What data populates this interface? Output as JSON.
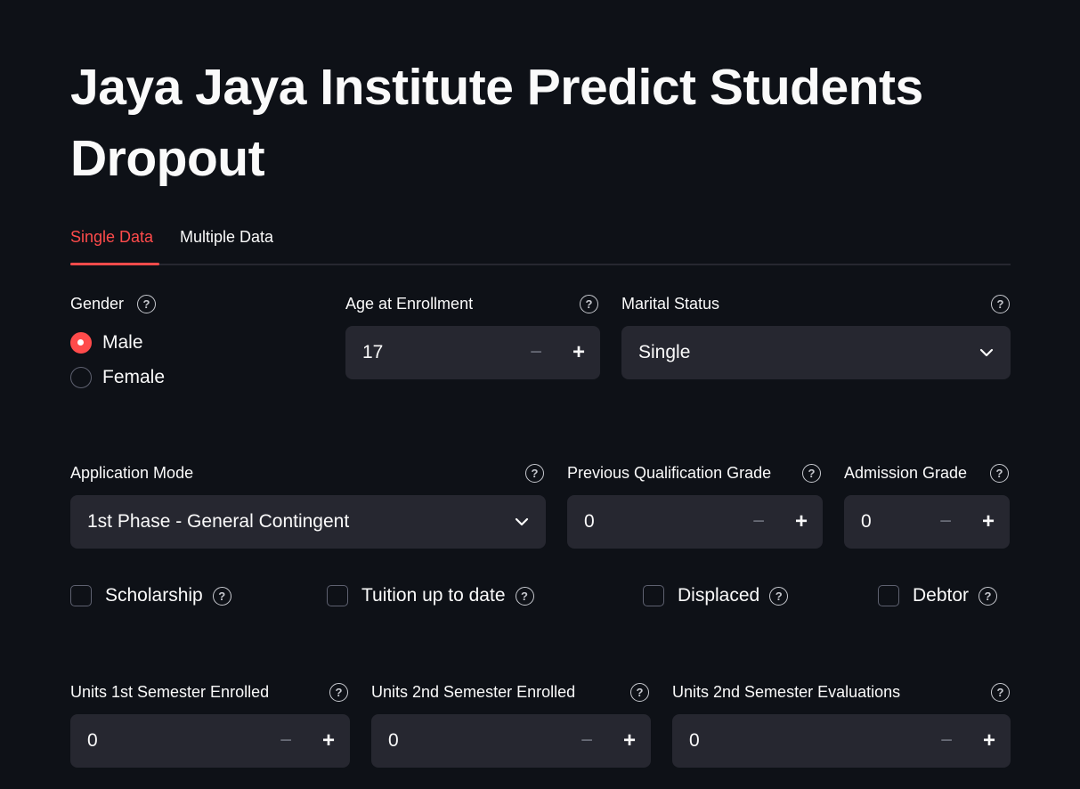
{
  "title": "Jaya Jaya Institute Predict Students Dropout",
  "tabs": [
    {
      "label": "Single Data",
      "active": true
    },
    {
      "label": "Multiple Data",
      "active": false
    }
  ],
  "gender": {
    "label": "Gender",
    "options": [
      "Male",
      "Female"
    ],
    "selected": "Male"
  },
  "age": {
    "label": "Age at Enrollment",
    "value": "17"
  },
  "marital": {
    "label": "Marital Status",
    "value": "Single"
  },
  "application_mode": {
    "label": "Application Mode",
    "value": "1st Phase - General Contingent"
  },
  "prev_grade": {
    "label": "Previous Qualification Grade",
    "value": "0"
  },
  "admission_grade": {
    "label": "Admission Grade",
    "value": "0"
  },
  "checkboxes": [
    {
      "label": "Scholarship",
      "checked": false
    },
    {
      "label": "Tuition up to date",
      "checked": false
    },
    {
      "label": "Displaced",
      "checked": false
    },
    {
      "label": "Debtor",
      "checked": false
    }
  ],
  "units_1st_enrolled": {
    "label": "Units 1st Semester Enrolled",
    "value": "0"
  },
  "units_2nd_enrolled": {
    "label": "Units 2nd Semester Enrolled",
    "value": "0"
  },
  "units_2nd_evaluations": {
    "label": "Units 2nd Semester Evaluations",
    "value": "0"
  },
  "stepper": {
    "minus": "−",
    "plus": "+"
  },
  "help_glyph": "?",
  "colors": {
    "background": "#0e1117",
    "accent": "#ff4b4b",
    "widget_bg": "#262730",
    "text": "#fafafa"
  }
}
